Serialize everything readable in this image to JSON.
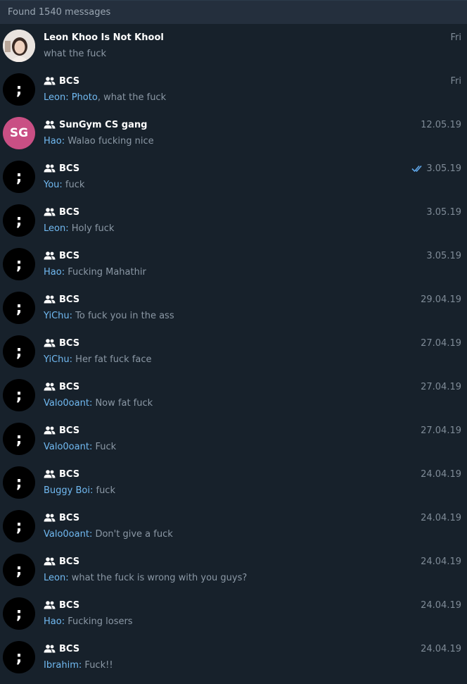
{
  "header": {
    "found_text": "Found 1540 messages"
  },
  "colors": {
    "background": "#17212b",
    "header": "#242f3d",
    "sender": "#71baf2",
    "initials_avatar": "#c94f84"
  },
  "results": [
    {
      "avatar": "photo",
      "group": false,
      "name": "Leon Khoo Is Not Khool",
      "date": "Fri",
      "sender": "",
      "text": "what the fuck"
    },
    {
      "avatar": "semicolon",
      "avatar_text": ";",
      "group": true,
      "name": "BCS",
      "date": "Fri",
      "sender": "Leon: Photo",
      "text": ", what the fuck"
    },
    {
      "avatar": "initials",
      "avatar_text": "SG",
      "group": true,
      "name": "SunGym CS gang",
      "date": "12.05.19",
      "sender": "Hao:",
      "text": " Walao fucking nice"
    },
    {
      "avatar": "semicolon",
      "avatar_text": ";",
      "group": true,
      "name": "BCS",
      "date": "3.05.19",
      "read": true,
      "sender": "You:",
      "text": " fuck"
    },
    {
      "avatar": "semicolon",
      "avatar_text": ";",
      "group": true,
      "name": "BCS",
      "date": "3.05.19",
      "sender": "Leon:",
      "text": " Holy fuck"
    },
    {
      "avatar": "semicolon",
      "avatar_text": ";",
      "group": true,
      "name": "BCS",
      "date": "3.05.19",
      "sender": "Hao:",
      "text": " Fucking Mahathir"
    },
    {
      "avatar": "semicolon",
      "avatar_text": ";",
      "group": true,
      "name": "BCS",
      "date": "29.04.19",
      "sender": "YiChu:",
      "text": " To fuck you in the ass"
    },
    {
      "avatar": "semicolon",
      "avatar_text": ";",
      "group": true,
      "name": "BCS",
      "date": "27.04.19",
      "sender": "YiChu:",
      "text": " Her fat fuck face"
    },
    {
      "avatar": "semicolon",
      "avatar_text": ";",
      "group": true,
      "name": "BCS",
      "date": "27.04.19",
      "sender": "Valo0oant:",
      "text": " Now fat fuck"
    },
    {
      "avatar": "semicolon",
      "avatar_text": ";",
      "group": true,
      "name": "BCS",
      "date": "27.04.19",
      "sender": "Valo0oant:",
      "text": " Fuck"
    },
    {
      "avatar": "semicolon",
      "avatar_text": ";",
      "group": true,
      "name": "BCS",
      "date": "24.04.19",
      "sender": "Buggy Boi:",
      "text": " fuck"
    },
    {
      "avatar": "semicolon",
      "avatar_text": ";",
      "group": true,
      "name": "BCS",
      "date": "24.04.19",
      "sender": "Valo0oant:",
      "text": " Don't give a fuck"
    },
    {
      "avatar": "semicolon",
      "avatar_text": ";",
      "group": true,
      "name": "BCS",
      "date": "24.04.19",
      "sender": "Leon:",
      "text": " what the fuck is wrong with you guys?"
    },
    {
      "avatar": "semicolon",
      "avatar_text": ";",
      "group": true,
      "name": "BCS",
      "date": "24.04.19",
      "sender": "Hao:",
      "text": " Fucking losers"
    },
    {
      "avatar": "semicolon",
      "avatar_text": ";",
      "group": true,
      "name": "BCS",
      "date": "24.04.19",
      "sender": "Ibrahim:",
      "text": " Fuck!!"
    }
  ]
}
